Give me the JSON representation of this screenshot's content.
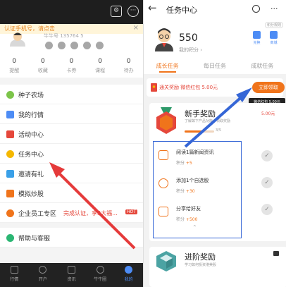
{
  "left": {
    "banner": {
      "text": "认证手机号，请点击",
      "close": "×"
    },
    "status": {
      "more": "···"
    },
    "profile": {
      "uid": "牛牛号  135764 5"
    },
    "stats": [
      {
        "value": "0",
        "label": "提醒"
      },
      {
        "value": "0",
        "label": "收藏"
      },
      {
        "value": "0",
        "label": "卡券"
      },
      {
        "value": "0",
        "label": "课程"
      },
      {
        "value": "0",
        "label": "待办"
      }
    ],
    "menu": [
      {
        "label": "种子农场",
        "color": "#7cc44a"
      },
      {
        "label": "我的行情",
        "color": "#4d8cf5"
      },
      {
        "label": "活动中心",
        "color": "#e5473b"
      },
      {
        "label": "任务中心",
        "color": "#f5b800"
      },
      {
        "label": "邀请有礼",
        "color": "#3aa0e8"
      },
      {
        "label": "模拟炒股",
        "color": "#f0741b"
      },
      {
        "label": "企业员工专区",
        "color": "#f0741b"
      }
    ],
    "menu_hint": "完成认证，享3大福...",
    "hot_badge": "HOT",
    "help": {
      "label": "帮助与客服"
    },
    "tabs": [
      {
        "label": "行情"
      },
      {
        "label": "开户"
      },
      {
        "label": "资讯"
      },
      {
        "label": "牛牛圈"
      },
      {
        "label": "我的"
      }
    ]
  },
  "right": {
    "header": {
      "back": "←",
      "title": "任务中心",
      "more": "···"
    },
    "user": {
      "points": "550",
      "points_label": "我的积分 ›",
      "rule": "积分规则",
      "actions": [
        {
          "label": "兑换"
        },
        {
          "label": "商城"
        }
      ]
    },
    "tabs": [
      {
        "label": "成长任务",
        "active": true
      },
      {
        "label": "每日任务",
        "active": false
      },
      {
        "label": "成就任务",
        "active": false
      }
    ],
    "reward_bar": {
      "text": "通关奖励 微信红包 5.00元",
      "button": "立即领取"
    },
    "tooltip": "微信红包 5.00元",
    "novice": {
      "title": "新手奖励",
      "subtitle": "了解如下产品功能，领取奖励",
      "progress_label": "3/5",
      "progress_fraction": 0.6,
      "bonus": "5.00元",
      "collapse": "⌃",
      "tasks": [
        {
          "title": "阅读1篇新闻资讯",
          "points_prefix": "积分 ",
          "points": "+5"
        },
        {
          "title": "添加1个自选股",
          "points_prefix": "积分 ",
          "points": "+30"
        },
        {
          "title": "分享给好友",
          "points_prefix": "积分 ",
          "points": "+500"
        }
      ]
    },
    "advanced": {
      "title": "进阶奖励",
      "subtitle": "学习如何投资港美股"
    }
  }
}
